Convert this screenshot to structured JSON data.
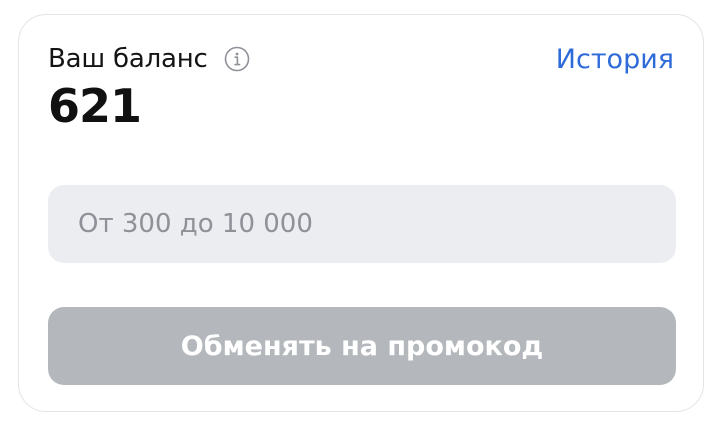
{
  "balance_card": {
    "title": "Ваш баланс",
    "history_link": "История",
    "balance_value": "621",
    "amount_input": {
      "value": "",
      "placeholder": "От 300 до 10 000"
    },
    "exchange_button": "Обменять на промокод"
  },
  "icons": {
    "info": "info-circle-icon"
  },
  "colors": {
    "link": "#2e6bd9",
    "input_bg": "#ecedf0",
    "button_disabled_bg": "#b4b8bd",
    "text": "#141414"
  }
}
